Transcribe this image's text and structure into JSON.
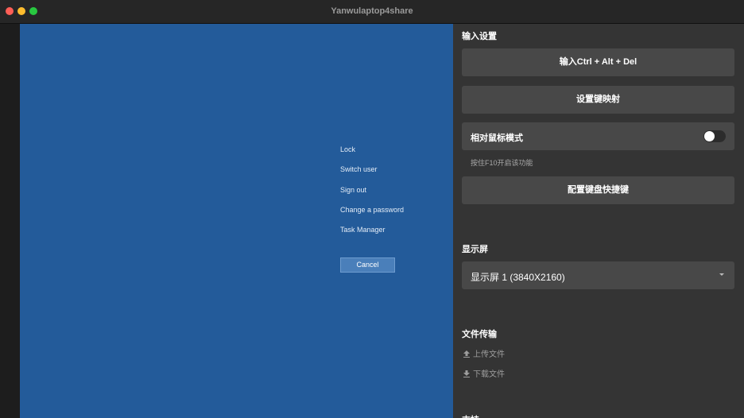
{
  "window": {
    "title": "Yanwulaptop4share"
  },
  "remote_screen": {
    "menu_items": [
      "Lock",
      "Switch user",
      "Sign out",
      "Change a password",
      "Task Manager"
    ],
    "cancel_label": "Cancel"
  },
  "panel": {
    "input_section": {
      "title": "输入设置",
      "ctrl_alt_del_label": "输入Ctrl + Alt + Del",
      "key_mapping_label": "设置键映射",
      "relative_mouse_label": "相对鼠标模式",
      "relative_mouse_on": false,
      "relative_mouse_hint": "按住F10开启该功能",
      "keyboard_shortcuts_label": "配置键盘快捷键"
    },
    "display_section": {
      "title": "显示屏",
      "selected_display": "显示屏 1 (3840X2160)"
    },
    "file_section": {
      "title": "文件传输",
      "upload_label": "上传文件",
      "download_label": "下载文件",
      "upload_icon": "upload-icon",
      "download_icon": "download-icon"
    },
    "next_section_title": "支持"
  },
  "colors": {
    "remote_background": "#235b9a",
    "panel_background": "#343434",
    "button_background": "#484848"
  }
}
